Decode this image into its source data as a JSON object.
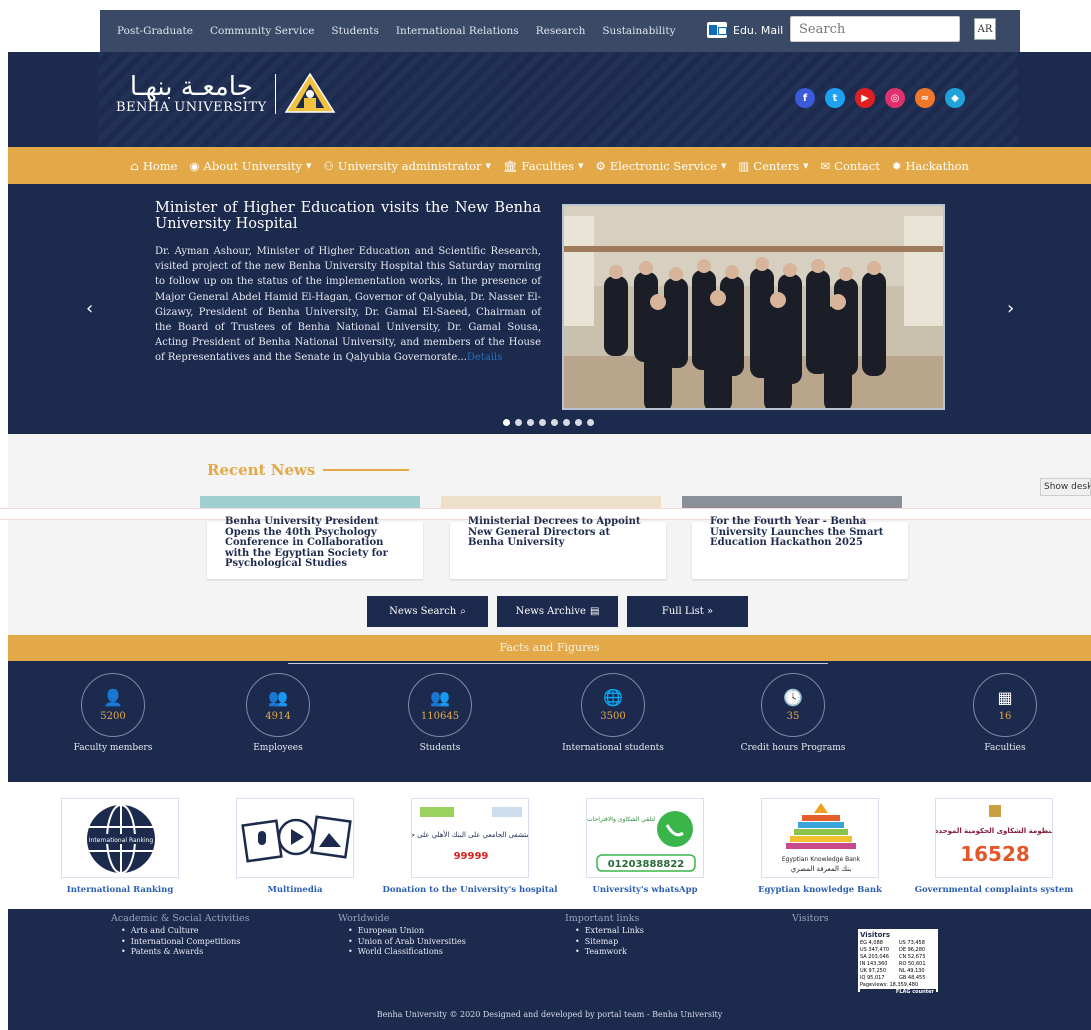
{
  "topbar": {
    "links": [
      "Post-Graduate",
      "Community Service",
      "Students",
      "International Relations",
      "Research",
      "Sustainability"
    ],
    "edu_mail": "Edu. Mail",
    "search_placeholder": "Search",
    "lang_button": "AR"
  },
  "header": {
    "logo_ar": "جامعـة بنهـا",
    "logo_en": "BENHA UNIVERSITY",
    "social": [
      {
        "icon": "facebook-icon",
        "glyph": "f",
        "color": "#3b5bdb"
      },
      {
        "icon": "twitter-icon",
        "glyph": "t",
        "color": "#1da1f2"
      },
      {
        "icon": "youtube-icon",
        "glyph": "▶",
        "color": "#e02020"
      },
      {
        "icon": "instagram-icon",
        "glyph": "◎",
        "color": "#e1306c"
      },
      {
        "icon": "rss-icon",
        "glyph": "≈",
        "color": "#f0782a"
      },
      {
        "icon": "link-icon",
        "glyph": "◆",
        "color": "#1fa3d8"
      }
    ]
  },
  "nav": {
    "home": "Home",
    "about": "About University",
    "admin": "University administrator",
    "faculties": "Faculties",
    "eservice": "Electronic Service",
    "centers": "Centers",
    "contact": "Contact",
    "hackathon": "Hackathon"
  },
  "slider": {
    "title": "Minister of Higher Education visits the New Benha University Hospital",
    "body": "Dr. Ayman Ashour, Minister of Higher Education and Scientific Research, visited project of the new Benha University Hospital this Saturday morning to follow up on the status of the implementation works, in the presence of Major General Abdel Hamid El-Hagan, Governor of Qalyubia, Dr. Nasser El-Gizawy, President of Benha University, Dr. Gamal El-Saeed, Chairman of the Board of Trustees of Benha National University, Dr. Gamal Sousa, Acting President of Benha National University, and members of the House of Representatives and the Senate in Qalyubia Governorate...",
    "details": "Details",
    "dots": 8,
    "active_dot": 0
  },
  "recent_news": {
    "title": "Recent News",
    "show_desktop": "Show desktop",
    "cards": [
      "Benha University President Opens the 40th Psychology Conference in Collaboration with the Egyptian Society for Psychological Studies",
      "Ministerial Decrees to Appoint New General Directors at Benha University",
      "For the Fourth Year - Benha University Launches the Smart Education Hackathon 2025"
    ],
    "buttons": {
      "search": "News Search",
      "archive": "News Archive",
      "full": "Full List »"
    }
  },
  "facts": {
    "title": "Facts and Figures",
    "items": [
      {
        "icon": "faculty-icon",
        "glyph": "👤",
        "num": "5200",
        "label": "Faculty members"
      },
      {
        "icon": "employees-icon",
        "glyph": "👥",
        "num": "4914",
        "label": "Employees"
      },
      {
        "icon": "students-icon",
        "glyph": "👥",
        "num": "110645",
        "label": "Students"
      },
      {
        "icon": "globe-icon",
        "glyph": "🌐",
        "num": "3500",
        "label": "International students"
      },
      {
        "icon": "clock-icon",
        "glyph": "🕓",
        "num": "35",
        "label": "Credit hours Programs"
      },
      {
        "icon": "building-icon",
        "glyph": "▦",
        "num": "16",
        "label": "Faculties"
      }
    ]
  },
  "tiles": [
    {
      "label": "International Ranking",
      "text": "International Ranking"
    },
    {
      "label": "Multimedia"
    },
    {
      "label": "Donation to the University's hospital",
      "text": "للتبرع للمستشفى الجامعي على البنك الأهلي على حساب رقم",
      "num": "99999"
    },
    {
      "label": "University's whatsApp",
      "text": "لتلقي الشكاوى والاقتراحات",
      "num": "01203888822"
    },
    {
      "label": "Egyptian knowledge Bank",
      "text": "Egyptian Knowledge Bank",
      "text_ar": "بنك المعرفة المصري"
    },
    {
      "label": "Governmental complaints system",
      "text": "منظومة الشكاوى الحكومية الموحدة",
      "num": "16528"
    }
  ],
  "footer": {
    "cols": [
      {
        "title": "Academic & Social Activities",
        "items": [
          "Arts and Culture",
          "International Competitions",
          "Patents & Awards"
        ]
      },
      {
        "title": "Worldwide",
        "items": [
          "European Union",
          "Union of Arab Universities",
          "World Classifications"
        ]
      },
      {
        "title": "Important links",
        "items": [
          "External Links",
          "Sitemap",
          "Teamwork"
        ]
      },
      {
        "title": "Visitors",
        "items": []
      }
    ],
    "counter": {
      "title": "Visitors",
      "rows": [
        "EG 4,088",
        "US 73,458",
        "US 347,470",
        "DE 96,280",
        "SA 203,046",
        "CN 52,673",
        "IN 143,360",
        "RO 50,601",
        "UK 97,250",
        "NL 49,130",
        "IQ 95,017",
        "GB 48,455"
      ],
      "pageviews": "Pageviews: 18,359,480",
      "brand": "FLAG counter"
    },
    "copyright": "Benha University © 2020 Designed and developed by portal team - Benha University"
  }
}
